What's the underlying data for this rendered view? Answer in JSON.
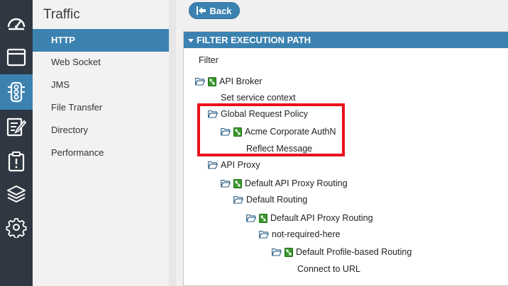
{
  "rail": {
    "items": [
      {
        "icon": "dashboard-gauge-icon"
      },
      {
        "icon": "window-icon"
      },
      {
        "icon": "traffic-light-icon",
        "active": true
      },
      {
        "icon": "edit-document-icon"
      },
      {
        "icon": "clipboard-alert-icon"
      },
      {
        "icon": "layers-stack-icon"
      },
      {
        "icon": "gear-icon"
      }
    ]
  },
  "subnav": {
    "title": "Traffic",
    "items": [
      {
        "label": "HTTP",
        "active": true
      },
      {
        "label": "Web Socket"
      },
      {
        "label": "JMS"
      },
      {
        "label": "File Transfer"
      },
      {
        "label": "Directory"
      },
      {
        "label": "Performance"
      }
    ]
  },
  "main": {
    "back_label": "Back",
    "panel_title": "FILTER EXECUTION PATH",
    "tree": [
      {
        "label": "Filter",
        "icon": "none"
      },
      {
        "label": "API Broker",
        "icon": "folder-badge"
      },
      {
        "label": "Set service context",
        "icon": "none"
      },
      {
        "label": "Global Request Policy",
        "icon": "folder"
      },
      {
        "label": "Acme Corporate AuthN",
        "icon": "folder-badge"
      },
      {
        "label": "Reflect Message",
        "icon": "none"
      },
      {
        "label": "API Proxy",
        "icon": "folder"
      },
      {
        "label": "Default API Proxy Routing",
        "icon": "folder-badge"
      },
      {
        "label": "Default Routing",
        "icon": "folder"
      },
      {
        "label": "Default API Proxy Routing",
        "icon": "folder-badge"
      },
      {
        "label": "not-required-here",
        "icon": "folder"
      },
      {
        "label": "Default Profile-based Routing",
        "icon": "folder-badge"
      },
      {
        "label": "Connect to URL",
        "icon": "none"
      }
    ]
  },
  "colors": {
    "rail_bg": "#2f3842",
    "accent": "#3b82b1",
    "highlight": "#e8111c",
    "badge_green": "#3a9a2c"
  }
}
